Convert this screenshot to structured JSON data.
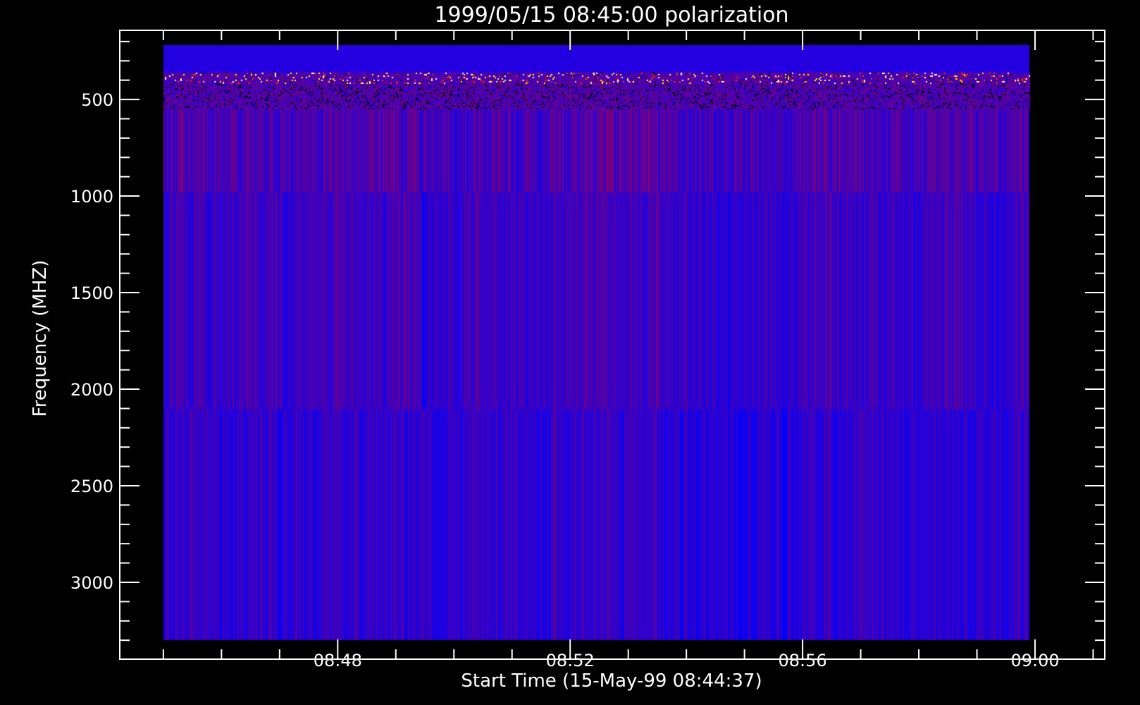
{
  "chart_data": {
    "type": "heatmap",
    "title": "1999/05/15 08:45:00 polarization",
    "xlabel": "Start Time (15-May-99 08:44:37)",
    "ylabel": "Frequency (MHZ)",
    "x_unit": "minutes after 08:00",
    "xlim": [
      44.25,
      61.2
    ],
    "ylim": [
      3398,
      142
    ],
    "y_inverted": true,
    "x_major_ticks": [
      48,
      52,
      56,
      60
    ],
    "x_tick_labels": [
      "08:48",
      "08:52",
      "08:56",
      "09:00"
    ],
    "x_minor_step": 1,
    "y_major_ticks": [
      500,
      1000,
      1500,
      2000,
      2500,
      3000
    ],
    "y_tick_labels": [
      "500",
      "1000",
      "1500",
      "2000",
      "2500",
      "3000"
    ],
    "y_minor_step": 100,
    "data_extent": {
      "x": [
        45.0,
        59.9
      ],
      "y": [
        219,
        3299
      ]
    },
    "bands": [
      {
        "name": "quiet-top",
        "from": 219,
        "to": 361
      },
      {
        "name": "interference",
        "from": 361,
        "to": 551
      },
      {
        "name": "band-1",
        "from": 551,
        "to": 982
      },
      {
        "name": "band-2",
        "from": 982,
        "to": 2106
      },
      {
        "name": "band-3",
        "from": 2106,
        "to": 3299
      }
    ],
    "colormap": [
      "#0000ff",
      "#5a00a0",
      "#a00040",
      "#ff0000",
      "#ffff00",
      "#ffffff"
    ],
    "grid": false,
    "legend": "none"
  }
}
